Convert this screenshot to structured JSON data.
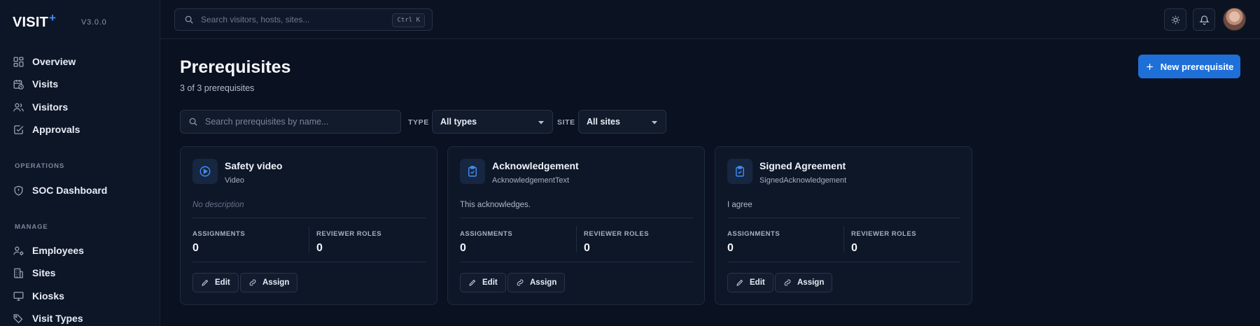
{
  "brand": {
    "name": "VISIT",
    "plus": "+",
    "version": "V3.0.0"
  },
  "sidebar": {
    "main_items": [
      {
        "label": "Overview",
        "icon": "grid-icon"
      },
      {
        "label": "Visits",
        "icon": "calendar-clock-icon"
      },
      {
        "label": "Visitors",
        "icon": "users-icon"
      },
      {
        "label": "Approvals",
        "icon": "check-square-icon"
      }
    ],
    "sections": {
      "operations": "OPERATIONS",
      "manage": "MANAGE"
    },
    "operations_items": [
      {
        "label": "SOC Dashboard",
        "icon": "shield-icon"
      }
    ],
    "manage_items": [
      {
        "label": "Employees",
        "icon": "user-cog-icon"
      },
      {
        "label": "Sites",
        "icon": "building-icon"
      },
      {
        "label": "Kiosks",
        "icon": "monitor-icon"
      },
      {
        "label": "Visit Types",
        "icon": "tags-icon"
      }
    ]
  },
  "topbar": {
    "search_placeholder": "Search visitors, hosts, sites...",
    "shortcut": "Ctrl K"
  },
  "page": {
    "title": "Prerequisites",
    "subtitle": "3 of 3 prerequisites",
    "new_button": "New prerequisite"
  },
  "filters": {
    "search_placeholder": "Search prerequisites by name...",
    "type_label": "TYPE",
    "type_value": "All types",
    "site_label": "SITE",
    "site_value": "All sites"
  },
  "cards": [
    {
      "name": "Safety video",
      "type": "Video",
      "description": "No description",
      "icon": "play-circle-icon",
      "assignments_label": "ASSIGNMENTS",
      "assignments": "0",
      "reviewer_roles_label": "REVIEWER ROLES",
      "reviewer_roles": "0",
      "edit_label": "Edit",
      "assign_label": "Assign"
    },
    {
      "name": "Acknowledgement",
      "type": "AcknowledgementText",
      "description": "This acknowledges.",
      "icon": "clipboard-check-icon",
      "assignments_label": "ASSIGNMENTS",
      "assignments": "0",
      "reviewer_roles_label": "REVIEWER ROLES",
      "reviewer_roles": "0",
      "edit_label": "Edit",
      "assign_label": "Assign"
    },
    {
      "name": "Signed Agreement",
      "type": "SignedAcknowledgement",
      "description": "I agree",
      "icon": "clipboard-check-icon",
      "assignments_label": "ASSIGNMENTS",
      "assignments": "0",
      "reviewer_roles_label": "REVIEWER ROLES",
      "reviewer_roles": "0",
      "edit_label": "Edit",
      "assign_label": "Assign"
    }
  ],
  "colors": {
    "background": "#0a1120",
    "sidebar": "#0d1627",
    "accent": "#1f6fd8",
    "icon_blue": "#3f8ef5"
  }
}
